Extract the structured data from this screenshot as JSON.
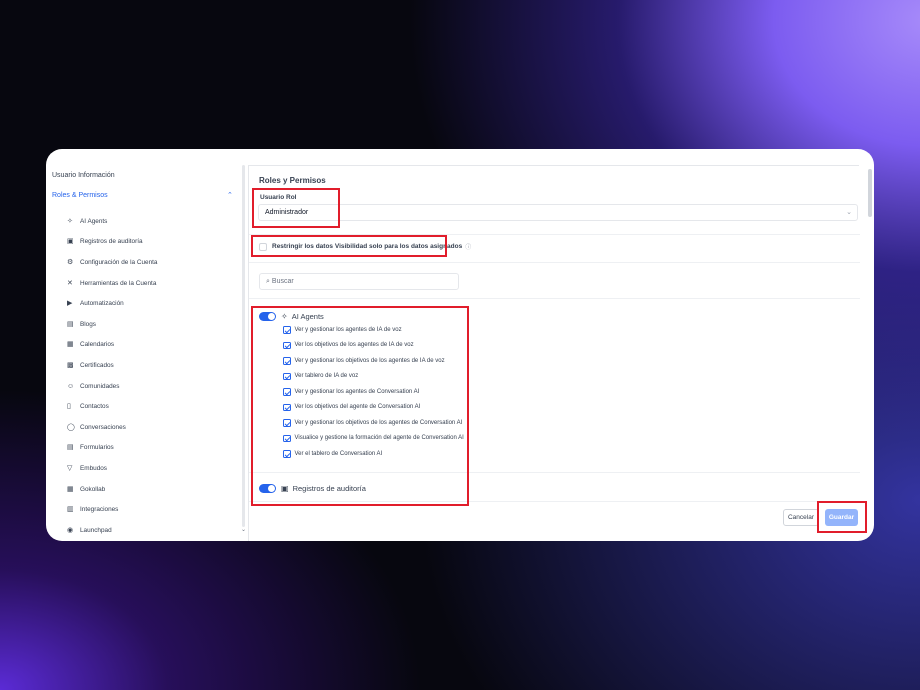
{
  "sidebar": {
    "top_item": "Usuario Información",
    "group_label": "Roles & Permisos",
    "items": [
      {
        "label": "AI Agents",
        "icon": "wand-icon"
      },
      {
        "label": "Registros de auditoría",
        "icon": "clipboard-icon"
      },
      {
        "label": "Configuración de la Cuenta",
        "icon": "gear-icon"
      },
      {
        "label": "Herramientas de la Cuenta",
        "icon": "tools-icon"
      },
      {
        "label": "Automatización",
        "icon": "play-circle-icon"
      },
      {
        "label": "Blogs",
        "icon": "document-icon"
      },
      {
        "label": "Calendarios",
        "icon": "calendar-icon"
      },
      {
        "label": "Certificados",
        "icon": "certificate-icon"
      },
      {
        "label": "Comunidades",
        "icon": "users-icon"
      },
      {
        "label": "Contactos",
        "icon": "contact-book-icon"
      },
      {
        "label": "Conversaciones",
        "icon": "chat-icon"
      },
      {
        "label": "Formularios",
        "icon": "form-icon"
      },
      {
        "label": "Embudos",
        "icon": "funnel-icon"
      },
      {
        "label": "Gokollab",
        "icon": "grid-icon"
      },
      {
        "label": "Integraciones",
        "icon": "integration-icon"
      },
      {
        "label": "Launchpad",
        "icon": "rocket-icon"
      }
    ]
  },
  "main": {
    "title": "Roles y Permisos",
    "role_label": "Usuario Rol",
    "role_value": "Administrador",
    "restrict_label": "Restringir los datos Visibilidad solo para los datos asignados",
    "search_placeholder": "Buscar",
    "sections": [
      {
        "title": "AI Agents",
        "icon": "wand-icon",
        "enabled": true,
        "permissions": [
          "Ver y gestionar los agentes de IA de voz",
          "Ver los objetivos de los agentes de IA de voz",
          "Ver y gestionar los objetivos de los agentes de IA de voz",
          "Ver tablero de IA de voz",
          "Ver y gestionar los agentes de Conversation AI",
          "Ver los objetivos del agente de Conversation AI",
          "Ver y gestionar los objetivos de los agentes de Conversation AI",
          "Visualice y gestione la formación del agente de Conversation AI",
          "Ver el tablero de Conversation AI"
        ]
      },
      {
        "title": "Registros de auditoría",
        "icon": "clipboard-icon",
        "enabled": true
      }
    ],
    "cancel_label": "Cancelar",
    "save_label": "Guardar"
  },
  "colors": {
    "accent": "#2563eb",
    "highlight": "#e11d2b",
    "save_button": "#93b4fb"
  }
}
